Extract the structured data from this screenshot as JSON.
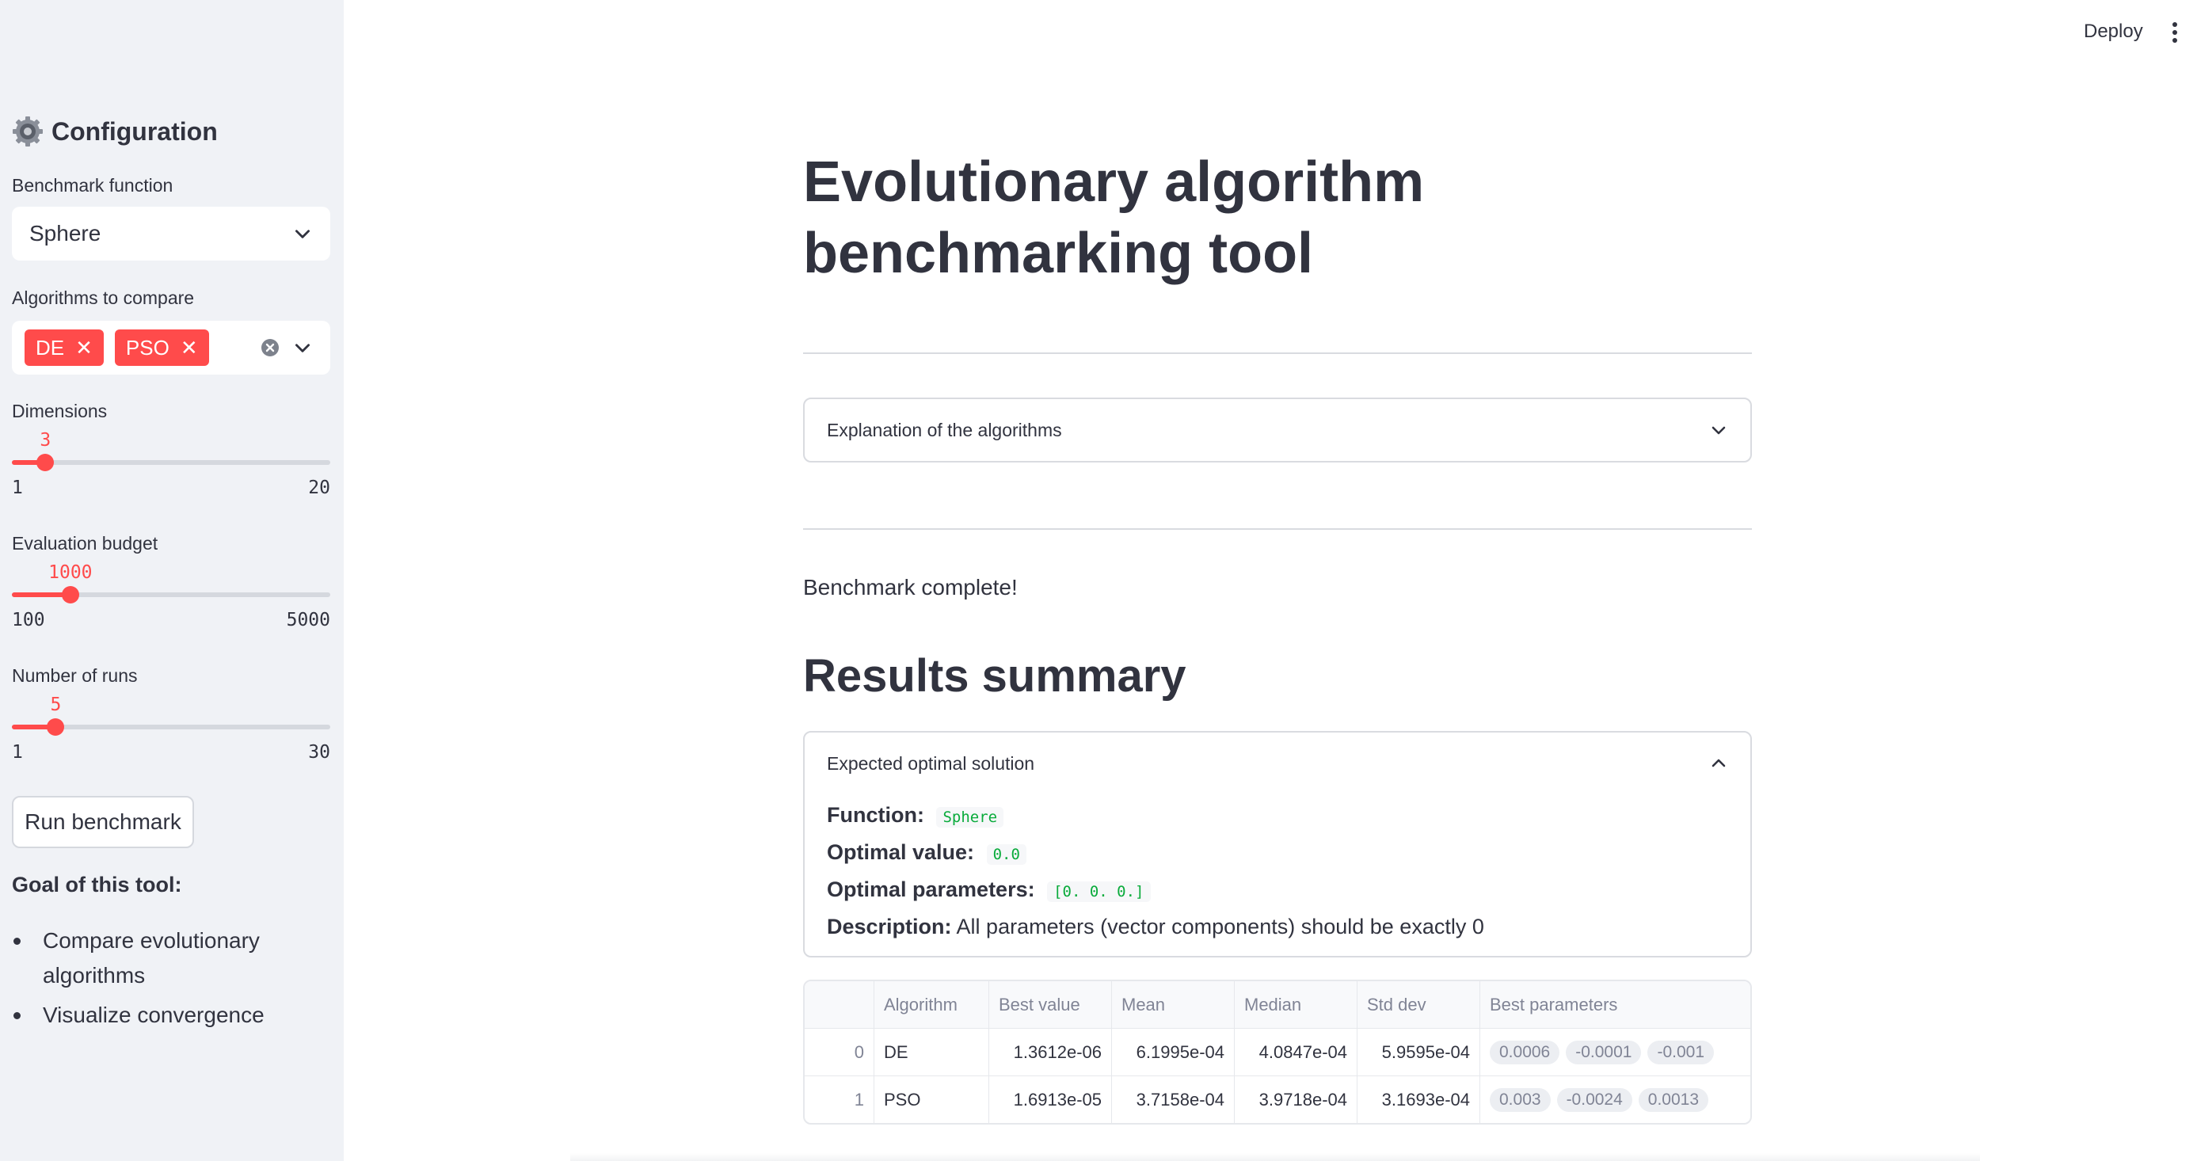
{
  "header": {
    "deploy_label": "Deploy"
  },
  "sidebar": {
    "title": "Configuration",
    "benchmark_function": {
      "label": "Benchmark function",
      "value": "Sphere"
    },
    "algorithms": {
      "label": "Algorithms to compare",
      "selected": [
        "DE",
        "PSO"
      ]
    },
    "dimensions": {
      "label": "Dimensions",
      "value": 3,
      "min": 1,
      "max": 20
    },
    "evaluation_budget": {
      "label": "Evaluation budget",
      "value": 1000,
      "min": 100,
      "max": 5000
    },
    "number_of_runs": {
      "label": "Number of runs",
      "value": 5,
      "min": 1,
      "max": 30
    },
    "run_button": "Run benchmark",
    "goal_title": "Goal of this tool:",
    "goals": [
      "Compare evolutionary algorithms",
      "Visualize convergence"
    ]
  },
  "main": {
    "title": "Evolutionary algorithm benchmarking tool",
    "explanation_expander": "Explanation of the algorithms",
    "status": "Benchmark complete!",
    "results_title": "Results summary",
    "optimal": {
      "expander_title": "Expected optimal solution",
      "function_label": "Function:",
      "function_value": "Sphere",
      "optimal_value_label": "Optimal value:",
      "optimal_value": "0.0",
      "optimal_params_label": "Optimal parameters:",
      "optimal_params": "[0. 0. 0.]",
      "description_label": "Description:",
      "description": "All parameters (vector components) should be exactly 0"
    },
    "table": {
      "columns": [
        "",
        "Algorithm",
        "Best value",
        "Mean",
        "Median",
        "Std dev",
        "Best parameters"
      ],
      "rows": [
        {
          "index": "0",
          "algorithm": "DE",
          "best": "1.3612e-06",
          "mean": "6.1995e-04",
          "median": "4.0847e-04",
          "std": "5.9595e-04",
          "params": [
            "0.0006",
            "-0.0001",
            "-0.001"
          ]
        },
        {
          "index": "1",
          "algorithm": "PSO",
          "best": "1.6913e-05",
          "mean": "3.7158e-04",
          "median": "3.9718e-04",
          "std": "3.1693e-04",
          "params": [
            "0.003",
            "-0.0024",
            "0.0013"
          ]
        }
      ]
    }
  },
  "colors": {
    "accent": "#ff4b4b",
    "sidebar_bg": "#f0f2f6",
    "code_green": "#09ab3b"
  }
}
